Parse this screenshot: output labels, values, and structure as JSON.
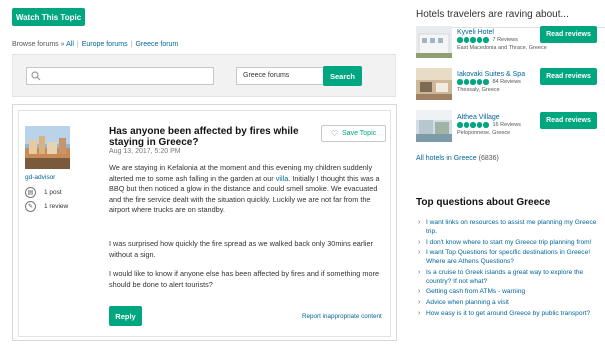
{
  "watch_label": "Watch This Topic",
  "breadcrumb": {
    "prefix": "Browse forums",
    "chevron": "»",
    "items": [
      "All",
      "Europe forums",
      "Greece forum"
    ]
  },
  "search": {
    "placeholder": "",
    "scope": "Greece forums",
    "button_label": "Search"
  },
  "post": {
    "username": "gd-advisor",
    "posts_count": "1 post",
    "reviews_count": "1 review",
    "title": "Has anyone been affected by fires while staying in Greece?",
    "date": "Aug 13, 2017, 5:20 PM",
    "save_label": "Save Topic",
    "paragraphs": {
      "p1_before": "We are staying in Kefalonia at the moment and this evening my children suddenly alterted me to some ash falling in the garden at our ",
      "p1_link": "villa",
      "p1_after": ". Initially I thought this was a BBQ but then noticed a glow in the distance and could smell smoke. We evacuated and the fire service dealt with the situation quickly. Luckily we are not far from the airport where trucks are on standby.",
      "p2": "I was surprised how quickly the fire spread as we walked back only 30mins earlier without a sign.",
      "p3": "I would like to know if anyone else has been affected by fires and if something more should be done to alert tourists?"
    },
    "reply_label": "Reply",
    "report_label": "Report inappropriate content"
  },
  "hotels": {
    "title": "Hotels travelers are raving about...",
    "items": [
      {
        "name": "Kyveli Hotel",
        "reviews": "7 Reviews",
        "location": "East Macedonia and Thrace, Greece",
        "rating": 5
      },
      {
        "name": "Iakovaki Suites & Spa",
        "reviews": "84 Reviews",
        "location": "Thessaly, Greece",
        "rating": 5
      },
      {
        "name": "Althea Village",
        "reviews": "16 Reviews",
        "location": "Peloponnese, Greece",
        "rating": 5
      }
    ],
    "read_label": "Read reviews",
    "all_label": "All hotels in Greece",
    "all_count": "(6836)"
  },
  "top_questions": {
    "title": "Top questions about Greece",
    "items": [
      "I want links on resources to assist me planning my Greece trip.",
      "I don't know where to start my Greece trip planning from!",
      "I want Top Questions for specific destinations in Greece! Where are Athens Questions?",
      "Is a cruise to Greek islands a great way to explore the country? If not what?",
      "Getting cash from ATMs - warning",
      "Advice when planning a visit",
      "How easy is it to get around Greece by public transport?"
    ]
  },
  "colors": {
    "accent": "#00a680",
    "link": "#006699"
  }
}
